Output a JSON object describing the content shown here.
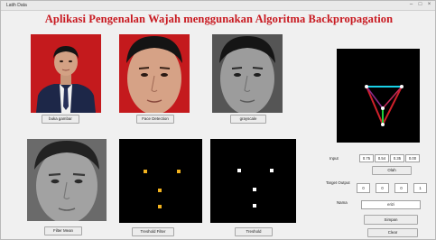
{
  "window": {
    "title": "Latih Data"
  },
  "heading": "Aplikasi Pengenalan Wajah menggunakan Algoritma Backpropagation",
  "buttons": {
    "buka_gambar": "buka gambar",
    "face_detection": "Face Detection",
    "grayscale": "grayscale",
    "filter_mean": "Filter Mean",
    "tresholds_filter": "Treshold Filter",
    "threshold": "Treshold",
    "olah": "Olah",
    "simpan": "Simpan",
    "clear": "Clear"
  },
  "input": {
    "label": "Input",
    "values": [
      "0.75",
      "0.54",
      "0.35",
      "0.00"
    ]
  },
  "target_output": {
    "label": "Target Output",
    "values": [
      "0",
      "0",
      "0",
      "1"
    ]
  },
  "nama": {
    "label": "Nama",
    "value": "erizi"
  },
  "colors": {
    "heading": "#c8181f",
    "photo_bg_red": "#c41a1d",
    "panel_bg": "#000000",
    "dot_yellow": "#f2b21e",
    "dot_white": "#ffffff"
  }
}
